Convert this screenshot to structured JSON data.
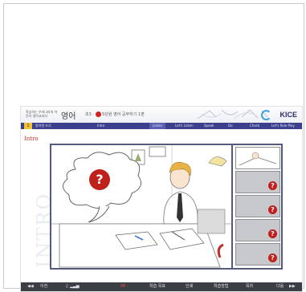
{
  "header": {
    "publisher_text": "학습하는 우리나라의 어린이 영어교과서",
    "subject": "영어",
    "breadcrumb_prefix": "초3 ·",
    "breadcrumb_lesson": "5단원",
    "breadcrumb_title": "영어 공부하기 1편",
    "brand": "KICE"
  },
  "nav": {
    "lesson_number": "1",
    "lesson_title": "말하면 쓰기",
    "items": [
      "Intro",
      "Listen",
      "Let's Listen",
      "Speak",
      "Do",
      "Check",
      "Let's Role Play"
    ]
  },
  "intro": {
    "label": "Intro",
    "vertical_label": "INTRO"
  },
  "main_scene": {
    "question_mark": "?",
    "accent": "#c0201c"
  },
  "thumbnails": [
    {
      "question": ""
    },
    {
      "question": "?"
    },
    {
      "question": "?"
    },
    {
      "question": "?"
    },
    {
      "question": "?"
    }
  ],
  "bottom_bar": {
    "prev_label": "이전",
    "page": "05",
    "items": [
      "학습 목표",
      "인쇄",
      "학습방법",
      "목차"
    ],
    "next_label": "다음"
  }
}
